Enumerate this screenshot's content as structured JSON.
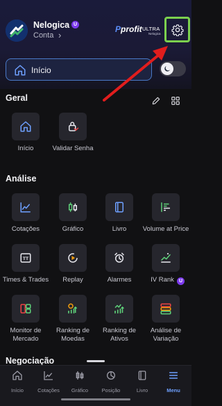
{
  "header": {
    "account_name": "Nelogica",
    "account_badge": "U",
    "account_subtitle": "Conta",
    "brand_name": "profit",
    "brand_tier": "ULTRA",
    "brand_owner": "Nelogica"
  },
  "home_button": {
    "label": "Início"
  },
  "theme_toggle": {
    "state": "dark",
    "icon": "moon-icon"
  },
  "sections": {
    "geral": {
      "title": "Geral",
      "items": [
        {
          "label": "Início",
          "icon": "home-icon"
        },
        {
          "label": "Validar Senha",
          "icon": "lock-check-icon"
        }
      ]
    },
    "analise": {
      "title": "Análise",
      "items": [
        {
          "label": "Cotações",
          "icon": "line-chart-icon"
        },
        {
          "label": "Gráfico",
          "icon": "candlestick-icon"
        },
        {
          "label": "Livro",
          "icon": "book-icon"
        },
        {
          "label": "Volume at Price",
          "icon": "volume-bars-icon"
        },
        {
          "label": "Times & Trades",
          "icon": "tt-icon"
        },
        {
          "label": "Replay",
          "icon": "replay-icon"
        },
        {
          "label": "Alarmes",
          "icon": "alarm-icon"
        },
        {
          "label": "IV Rank",
          "icon": "iv-rank-icon",
          "badge": "U"
        },
        {
          "label": "Monitor de Mercado",
          "icon": "monitor-icon"
        },
        {
          "label": "Ranking de Moedas",
          "icon": "coin-ranking-icon"
        },
        {
          "label": "Ranking de Ativos",
          "icon": "asset-ranking-icon"
        },
        {
          "label": "Análise de Variação",
          "icon": "variation-icon"
        }
      ]
    },
    "negociacao": {
      "title": "Negociação"
    }
  },
  "tabbar": {
    "tabs": [
      {
        "label": "Início",
        "icon": "home-icon"
      },
      {
        "label": "Cotações",
        "icon": "line-chart-icon"
      },
      {
        "label": "Gráfico",
        "icon": "candlestick-icon"
      },
      {
        "label": "Posição",
        "icon": "pie-chart-icon"
      },
      {
        "label": "Livro",
        "icon": "book-icon"
      },
      {
        "label": "Menu",
        "icon": "menu-icon",
        "active": true
      }
    ]
  },
  "colors": {
    "accent": "#6ea0ff",
    "highlight_frame": "#7bd04e",
    "annotation_arrow": "#e11d1d",
    "icon_green": "#5fd27a",
    "icon_blue": "#6ea0ff",
    "icon_orange": "#f59e0b",
    "icon_red": "#ef4444",
    "premium_badge": "#7c3aed"
  }
}
